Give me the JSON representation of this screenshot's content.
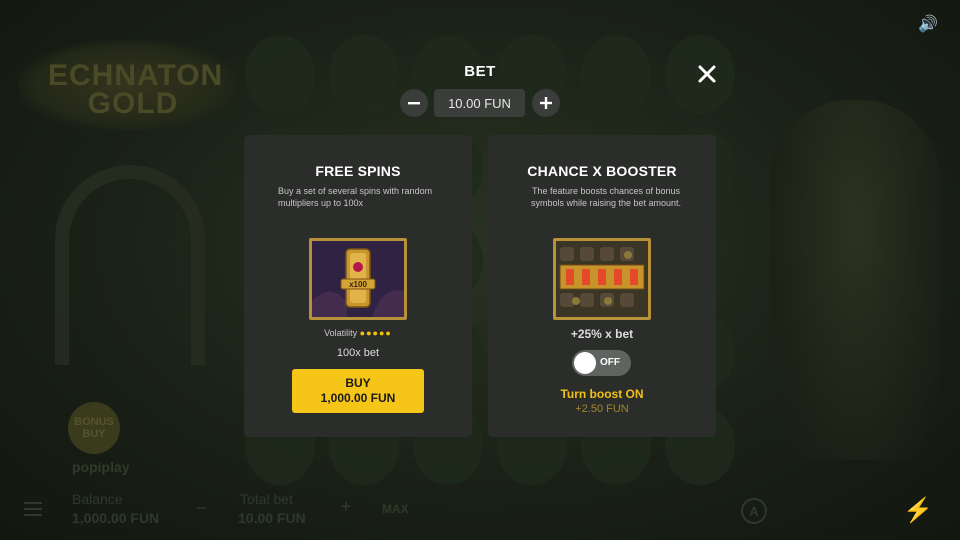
{
  "background": {
    "logo_text": "ECHNATON GOLD",
    "bonus_buy": "BONUS BUY",
    "brand": "popiplay",
    "balance_label": "Balance",
    "balance_value": "1,000.00 FUN",
    "total_bet_label": "Total bet",
    "total_bet_value": "10.00 FUN",
    "max_label": "MAX",
    "autoplay_label": "A"
  },
  "modal": {
    "title": "BET",
    "bet_value": "10.00 FUN",
    "close_icon": "close-icon",
    "minus_icon": "minus-icon",
    "plus_icon": "plus-icon"
  },
  "free_spins": {
    "title": "FREE SPINS",
    "description": "Buy a set of several spins with random multipliers up to 100x",
    "volatility_label": "Volatility",
    "volatility_level": 5,
    "volatility_max": 5,
    "multiplier_text": "100x bet",
    "buy_label": "BUY",
    "buy_price": "1,000.00 FUN"
  },
  "booster": {
    "title": "CHANCE X BOOSTER",
    "description": "The feature boosts chances of bonus symbols while raising the bet amount.",
    "boost_text": "+25% x bet",
    "toggle_state": "OFF",
    "turn_label": "Turn boost ON",
    "extra_cost": "+2.50 FUN"
  },
  "colors": {
    "accent": "#f5c518",
    "panel": "#2b2d2b",
    "button_dark": "#3a3d3a"
  }
}
